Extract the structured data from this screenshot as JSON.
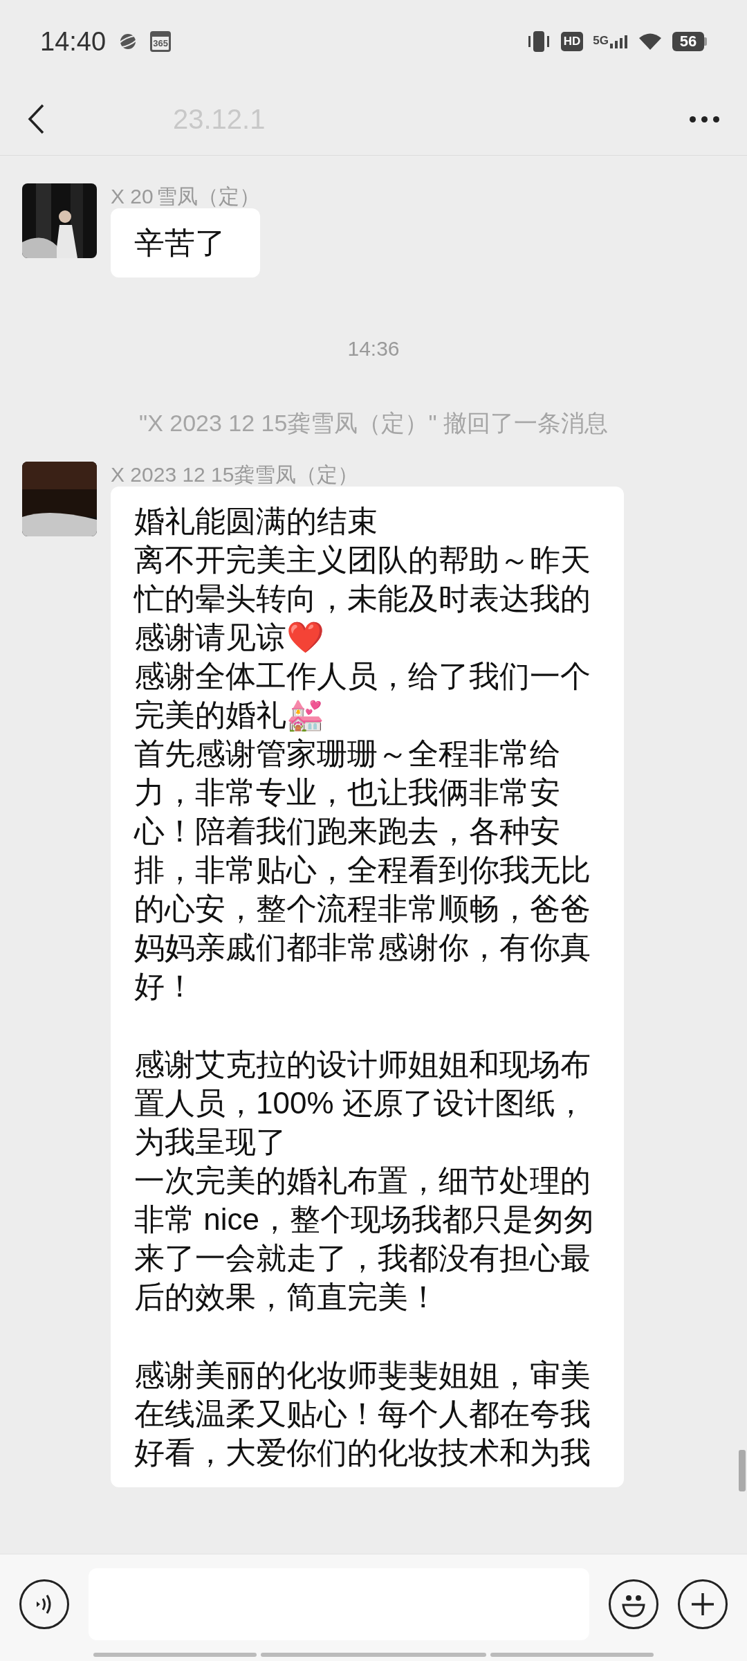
{
  "status_bar": {
    "time": "14:40",
    "calendar_badge": "365",
    "hd": "HD",
    "network": "5G",
    "battery": "56"
  },
  "header": {
    "title": "23.12.1"
  },
  "messages": [
    {
      "kind": "bubble",
      "sender_parts": [
        "X 20",
        "雪凤（定）"
      ],
      "avatar": {
        "kind": "picture"
      },
      "paragraphs": [
        [
          "辛苦了"
        ]
      ]
    },
    {
      "kind": "time",
      "text": "14:36"
    },
    {
      "kind": "notice",
      "text": "\"X 2023 12 15龚雪凤（定）\" 撤回了一条消息"
    },
    {
      "kind": "bubble",
      "sender_parts": [
        "X 2023 12 15龚雪凤（定）"
      ],
      "avatar": {
        "kind": "picture"
      },
      "paragraphs": [
        [
          "婚礼能圆满的结束",
          "离不开完美主义团队的帮助～昨天忙的晕头转向，未能及时表达我的感谢请见谅❤️",
          "感谢全体工作人员，给了我们一个完美的婚礼💒",
          "首先感谢管家珊珊～全程非常给力，非常专业，也让我俩非常安心！陪着我们跑来跑去，各种安排，非常贴心，全程看到你我无比的心安，整个流程非常顺畅，爸爸妈妈亲戚们都非常感谢你，有你真好！"
        ],
        [
          "感谢艾克拉的设计师姐姐和现场布置人员，100% 还原了设计图纸，为我呈现了",
          "一次完美的婚礼布置，细节处理的非常 nice，整个现场我都只是匆匆来了一会就走了，我都没有担心最后的效果，简直完美！"
        ],
        [
          "感谢美丽的化妆师斐斐姐姐，审美在线温柔又贴心！每个人都在夸我好看，大爱你们的化妆技术和为我"
        ]
      ]
    }
  ]
}
